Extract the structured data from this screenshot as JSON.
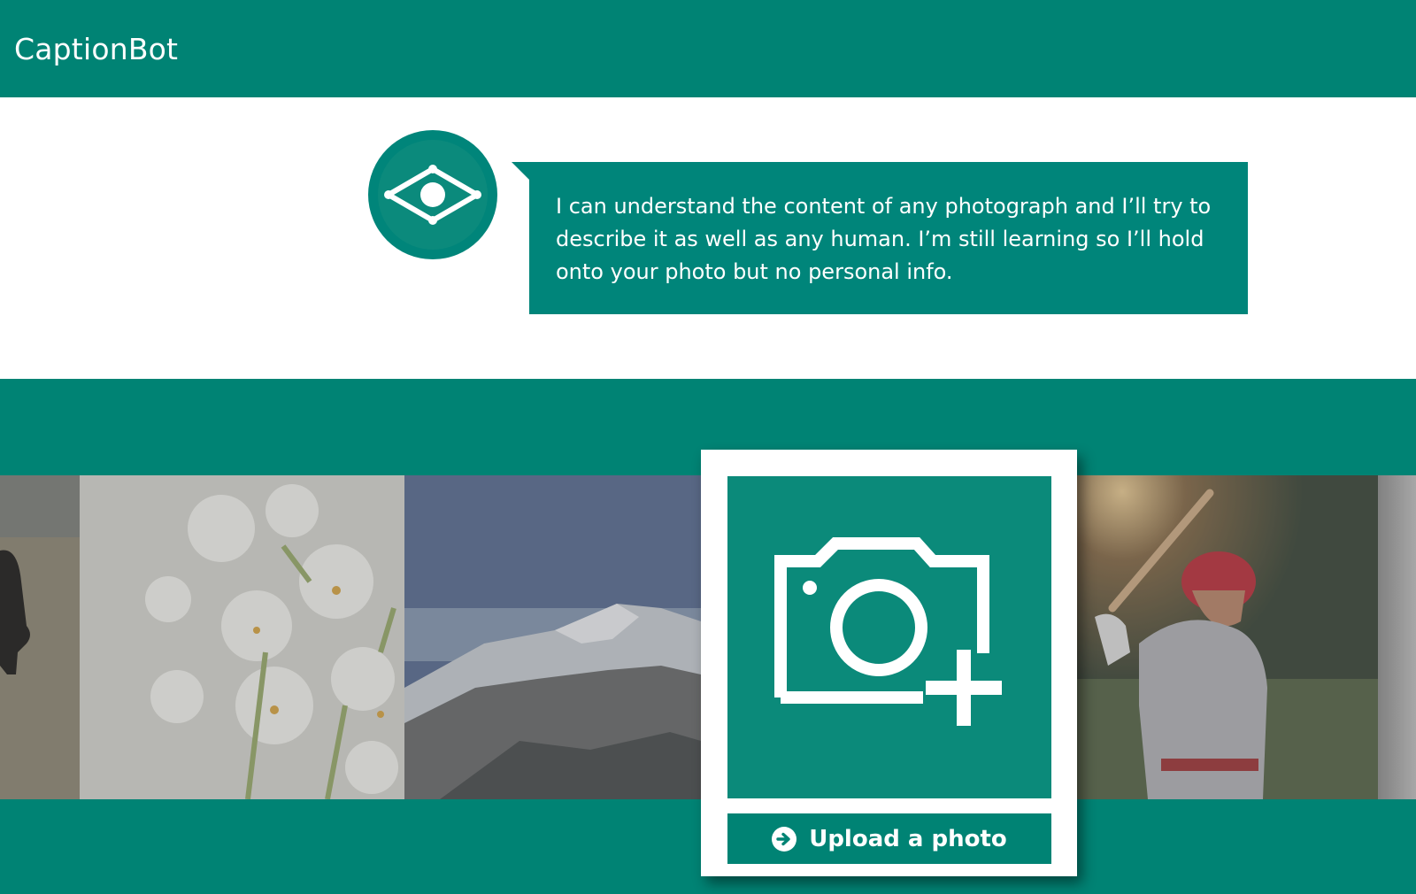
{
  "header": {
    "title": "CaptionBot"
  },
  "intro": {
    "bot_icon": "eye-diamond-icon",
    "message": "I can understand the content of any photograph and I’ll try to describe it as well as any human. I’m still learning so I’ll hold onto your photo but no personal info."
  },
  "gallery": {
    "images": [
      {
        "subject": "cow-grazing"
      },
      {
        "subject": "white-flowers"
      },
      {
        "subject": "snowy-mountain"
      },
      {
        "subject": "baseball-batter"
      },
      {
        "subject": "grey-partial"
      }
    ]
  },
  "upload": {
    "icon": "camera-plus-icon",
    "button_icon": "arrow-right-circle-icon",
    "button_label": "Upload a photo"
  },
  "colors": {
    "brand": "#008374",
    "bubble": "#00857a",
    "upload_tile": "#0b8a7a",
    "white": "#ffffff"
  }
}
